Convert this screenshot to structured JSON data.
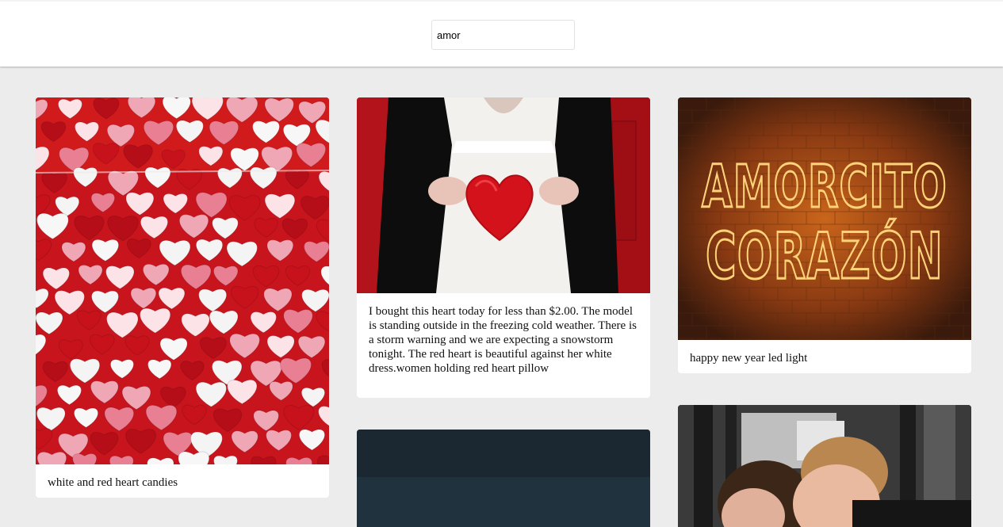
{
  "search": {
    "value": "amor"
  },
  "cards": [
    {
      "caption": "white and red heart candies"
    },
    {
      "caption": "I bought this heart today for less than $2.00. The model is standing outside in the freezing cold weather. There is a storm warning and we are expecting a snowstorm tonight. The red heart is beautiful against her white dress.women holding red heart pillow"
    },
    {
      "caption": "happy new year led light",
      "neon_text": [
        "AMORCITO",
        "CORAZÓN"
      ]
    },
    {
      "caption": ""
    },
    {
      "caption": ""
    }
  ]
}
